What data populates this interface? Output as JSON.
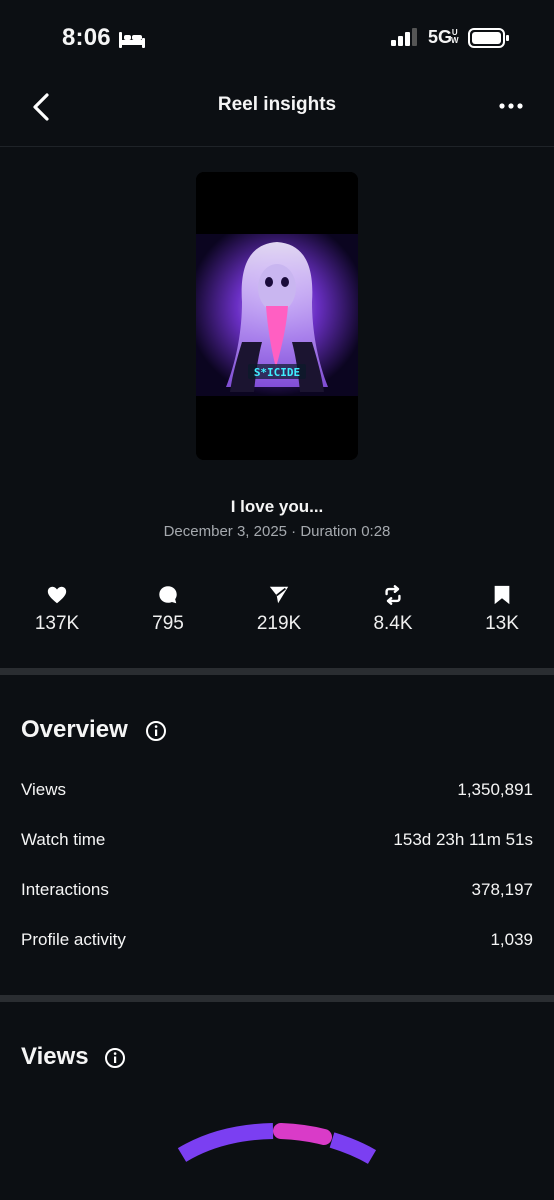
{
  "status_bar": {
    "time": "8:06",
    "network": "5G",
    "network_sup_top": "U",
    "network_sup_bottom": "W"
  },
  "nav": {
    "title": "Reel insights"
  },
  "reel": {
    "thumbnail_caption": "S*ICIDE",
    "title": "I love you...",
    "meta": "December 3, 2025 · Duration 0:28"
  },
  "stats": [
    {
      "icon": "heart-icon",
      "value": "137K"
    },
    {
      "icon": "comment-icon",
      "value": "795"
    },
    {
      "icon": "send-icon",
      "value": "219K"
    },
    {
      "icon": "repost-icon",
      "value": "8.4K"
    },
    {
      "icon": "bookmark-icon",
      "value": "13K"
    }
  ],
  "overview": {
    "title": "Overview",
    "rows": [
      {
        "label": "Views",
        "value": "1,350,891"
      },
      {
        "label": "Watch time",
        "value": "153d 23h 11m 51s"
      },
      {
        "label": "Interactions",
        "value": "378,197"
      },
      {
        "label": "Profile activity",
        "value": "1,039"
      }
    ]
  },
  "views_section": {
    "title": "Views"
  },
  "colors": {
    "background": "#0c0f13",
    "divider": "#2a2d31",
    "gauge_purple": "#7b3ff2",
    "gauge_pink": "#d93bc8",
    "muted_text": "#a5a9ae"
  }
}
